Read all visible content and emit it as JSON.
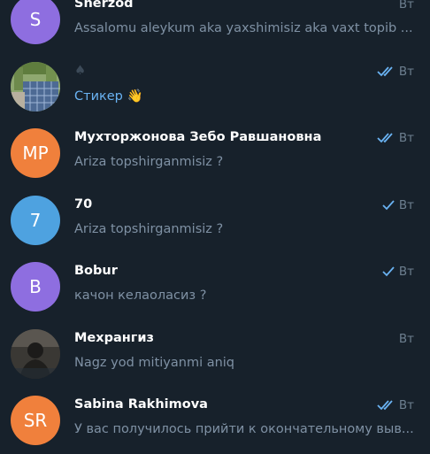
{
  "chats": [
    {
      "name": "Sherzod",
      "preview": "Assalomu aleykum aka yaxshimisiz  aka vaxt topib ...",
      "time": "Вт",
      "avatar": {
        "type": "initials",
        "initials": "S",
        "color": "#8e6ee0"
      },
      "status": "none"
    },
    {
      "name": "♠",
      "preview": "Стикер 👋",
      "time": "Вт",
      "avatar": {
        "type": "photo",
        "description_icon": "photo-avatar-icon"
      },
      "status": "double-check"
    },
    {
      "name": "Мухторжонова Зебо Равшановна",
      "preview": "Ariza topshirganmisiz ?",
      "time": "Вт",
      "avatar": {
        "type": "initials",
        "initials": "MP",
        "color": "#f0803c"
      },
      "status": "double-check"
    },
    {
      "name": "70",
      "preview": "Ariza topshirganmisiz ?",
      "time": "Вт",
      "avatar": {
        "type": "initials",
        "initials": "7",
        "color": "#4ea2e0"
      },
      "status": "single-check"
    },
    {
      "name": "Bobur",
      "preview": "качон келаоласиз ?",
      "time": "Вт",
      "avatar": {
        "type": "initials",
        "initials": "B",
        "color": "#8e6ee0"
      },
      "status": "single-check"
    },
    {
      "name": "Мехрангиз",
      "preview": "Nagz yod mitiyanmi aniq",
      "time": "Вт",
      "avatar": {
        "type": "photo",
        "description_icon": "photo-avatar-icon"
      },
      "status": "none"
    },
    {
      "name": "Sabina Rakhimova",
      "preview": "У вас получилось прийти к окончательному выв...",
      "time": "Вт",
      "avatar": {
        "type": "initials",
        "initials": "SR",
        "color": "#f0803c"
      },
      "status": "double-check"
    }
  ],
  "colors": {
    "background": "#17212b",
    "name": "#ffffff",
    "preview": "#7f91a4",
    "accent": "#6ab3f3",
    "time": "#6d7f8f",
    "check": "#6ab3f3"
  }
}
